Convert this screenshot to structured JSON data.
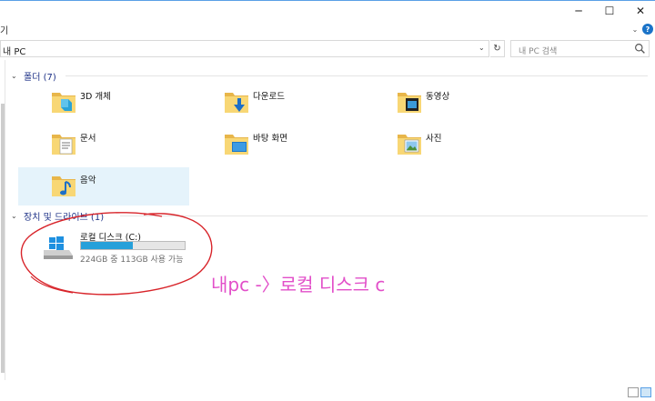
{
  "window": {
    "controls": {
      "minimize": "─",
      "maximize": "☐",
      "close": "✕"
    }
  },
  "ribbon": {
    "tab_label": "기",
    "expand_glyph": "⌄",
    "help_glyph": "?"
  },
  "address": {
    "path": "내 PC",
    "dropdown_glyph": "⌄",
    "refresh_glyph": "↻"
  },
  "search": {
    "placeholder": "내 PC 검색",
    "icon": "search-icon"
  },
  "sections": {
    "folders": {
      "title": "폴더 (7)",
      "items": [
        {
          "name": "3D 개체",
          "icon": "3d-objects-folder-icon"
        },
        {
          "name": "다운로드",
          "icon": "downloads-folder-icon"
        },
        {
          "name": "동영상",
          "icon": "videos-folder-icon"
        },
        {
          "name": "문서",
          "icon": "documents-folder-icon"
        },
        {
          "name": "바탕 화면",
          "icon": "desktop-folder-icon"
        },
        {
          "name": "사진",
          "icon": "pictures-folder-icon"
        },
        {
          "name": "음악",
          "icon": "music-folder-icon",
          "selected": true
        }
      ]
    },
    "drives": {
      "title": "장치 및 드라이브 (1)",
      "items": [
        {
          "name": "로컬 디스크 (C:)",
          "space": "224GB 중 113GB 사용 가능",
          "used_fraction": 0.496,
          "icon": "windows-drive-icon"
        }
      ]
    }
  },
  "annotation": {
    "text": "내pc -〉로컬 디스크 c",
    "color": "#e24fc9"
  },
  "colors": {
    "accent": "#26a0da",
    "selection": "#e5f3fb",
    "section_title": "#1e3287"
  }
}
